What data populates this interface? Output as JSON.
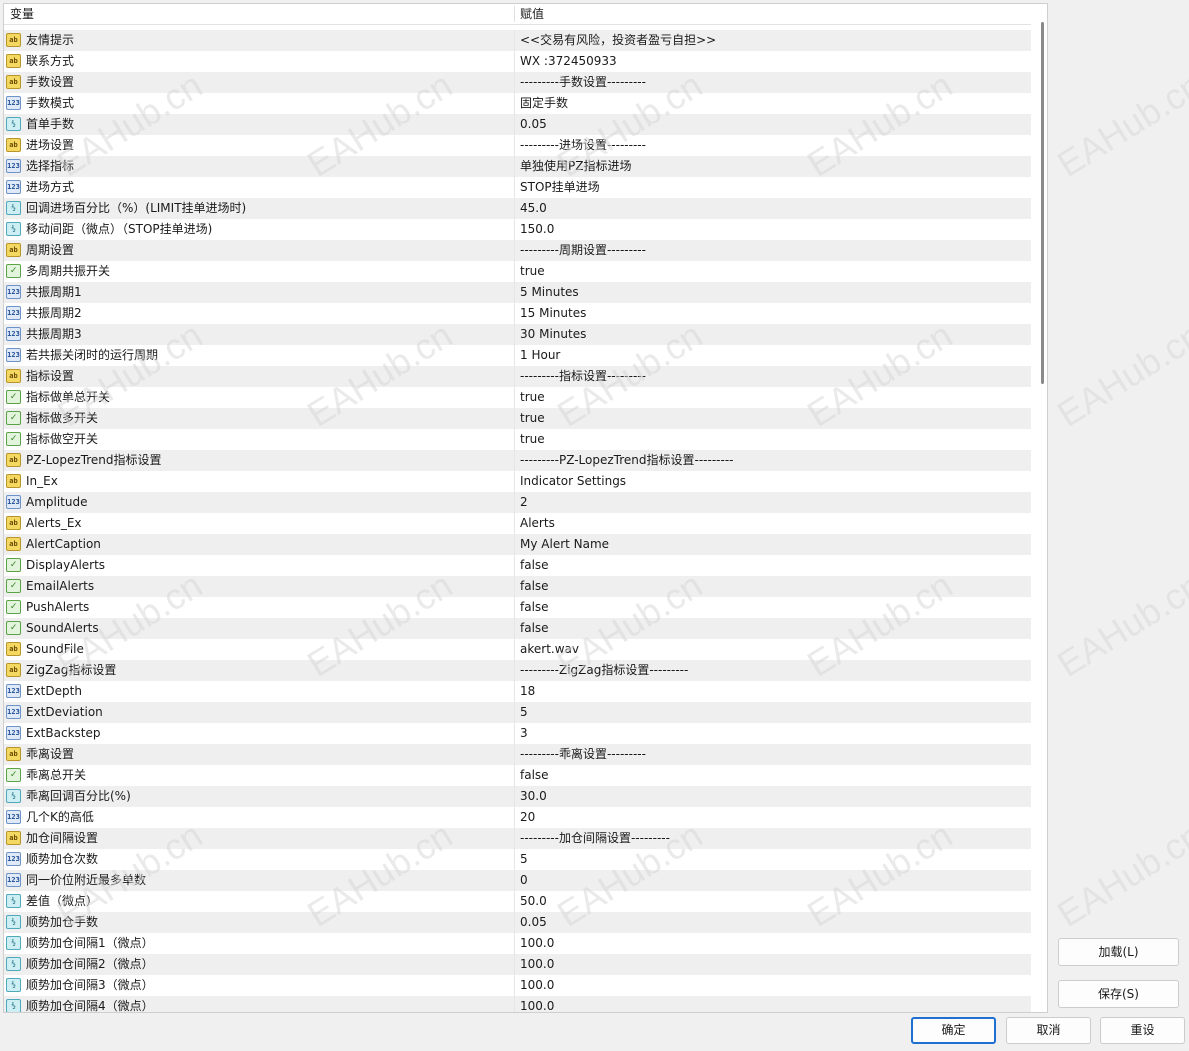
{
  "table": {
    "header": {
      "variable": "变量",
      "value": "赋值"
    },
    "rows": [
      {
        "icon": "ab",
        "name": "友情提示",
        "value": "<<交易有风险，投资者盈亏自担>>"
      },
      {
        "icon": "ab",
        "name": "联系方式",
        "value": "WX :372450933"
      },
      {
        "icon": "ab",
        "name": "手数设置",
        "value": "---------手数设置---------"
      },
      {
        "icon": "123",
        "name": "手数模式",
        "value": "固定手数"
      },
      {
        "icon": "v2",
        "name": "首单手数",
        "value": "0.05"
      },
      {
        "icon": "ab",
        "name": "进场设置",
        "value": "---------进场设置---------"
      },
      {
        "icon": "123",
        "name": "选择指标",
        "value": "单独使用PZ指标进场"
      },
      {
        "icon": "123",
        "name": "进场方式",
        "value": "STOP挂单进场"
      },
      {
        "icon": "v2",
        "name": "回调进场百分比（%）(LIMIT挂单进场时)",
        "value": "45.0"
      },
      {
        "icon": "v2",
        "name": "移动间距（微点）（STOP挂单进场)",
        "value": "150.0"
      },
      {
        "icon": "ab",
        "name": "周期设置",
        "value": "---------周期设置---------"
      },
      {
        "icon": "bool",
        "name": "多周期共振开关",
        "value": "true"
      },
      {
        "icon": "123",
        "name": "共振周期1",
        "value": "5 Minutes"
      },
      {
        "icon": "123",
        "name": "共振周期2",
        "value": "15 Minutes"
      },
      {
        "icon": "123",
        "name": "共振周期3",
        "value": "30 Minutes"
      },
      {
        "icon": "123",
        "name": "若共振关闭时的运行周期",
        "value": "1 Hour"
      },
      {
        "icon": "ab",
        "name": "指标设置",
        "value": "---------指标设置---------"
      },
      {
        "icon": "bool",
        "name": "指标做单总开关",
        "value": "true"
      },
      {
        "icon": "bool",
        "name": "指标做多开关",
        "value": "true"
      },
      {
        "icon": "bool",
        "name": "指标做空开关",
        "value": "true"
      },
      {
        "icon": "ab",
        "name": "PZ-LopezTrend指标设置",
        "value": "---------PZ-LopezTrend指标设置---------"
      },
      {
        "icon": "ab",
        "name": "In_Ex",
        "value": "Indicator Settings"
      },
      {
        "icon": "123",
        "name": "Amplitude",
        "value": "2"
      },
      {
        "icon": "ab",
        "name": "Alerts_Ex",
        "value": "Alerts"
      },
      {
        "icon": "ab",
        "name": "AlertCaption",
        "value": "My Alert Name"
      },
      {
        "icon": "bool",
        "name": "DisplayAlerts",
        "value": "false"
      },
      {
        "icon": "bool",
        "name": "EmailAlerts",
        "value": "false"
      },
      {
        "icon": "bool",
        "name": "PushAlerts",
        "value": "false"
      },
      {
        "icon": "bool",
        "name": "SoundAlerts",
        "value": "false"
      },
      {
        "icon": "ab",
        "name": "SoundFile",
        "value": "akert.wav"
      },
      {
        "icon": "ab",
        "name": "ZigZag指标设置",
        "value": "---------ZigZag指标设置---------"
      },
      {
        "icon": "123",
        "name": "ExtDepth",
        "value": "18"
      },
      {
        "icon": "123",
        "name": "ExtDeviation",
        "value": "5"
      },
      {
        "icon": "123",
        "name": "ExtBackstep",
        "value": "3"
      },
      {
        "icon": "ab",
        "name": "乖离设置",
        "value": "---------乖离设置---------"
      },
      {
        "icon": "bool",
        "name": "乖离总开关",
        "value": "false"
      },
      {
        "icon": "v2",
        "name": "乖离回调百分比(%)",
        "value": "30.0"
      },
      {
        "icon": "123",
        "name": "几个K的高低",
        "value": "20"
      },
      {
        "icon": "ab",
        "name": "加仓间隔设置",
        "value": "---------加仓间隔设置---------"
      },
      {
        "icon": "123",
        "name": "顺势加仓次数",
        "value": "5"
      },
      {
        "icon": "123",
        "name": "同一价位附近最多单数",
        "value": "0"
      },
      {
        "icon": "v2",
        "name": "差值（微点）",
        "value": "50.0"
      },
      {
        "icon": "v2",
        "name": "顺势加仓手数",
        "value": "0.05"
      },
      {
        "icon": "v2",
        "name": "顺势加仓间隔1（微点）",
        "value": "100.0"
      },
      {
        "icon": "v2",
        "name": "顺势加仓间隔2（微点）",
        "value": "100.0"
      },
      {
        "icon": "v2",
        "name": "顺势加仓间隔3（微点）",
        "value": "100.0"
      },
      {
        "icon": "v2",
        "name": "顺势加仓间隔4（微点）",
        "value": "100.0"
      }
    ]
  },
  "icon_glyphs": {
    "ab": "ab",
    "123": "123",
    "v2": "½",
    "bool": "✓"
  },
  "watermark": "EAHub.cn",
  "buttons": {
    "load": "加载(L)",
    "save": "保存(S)",
    "ok": "确定",
    "cancel": "取消",
    "reset": "重设"
  },
  "colors": {
    "accent": "#1f6fd1",
    "row_alt": "#efefef"
  }
}
